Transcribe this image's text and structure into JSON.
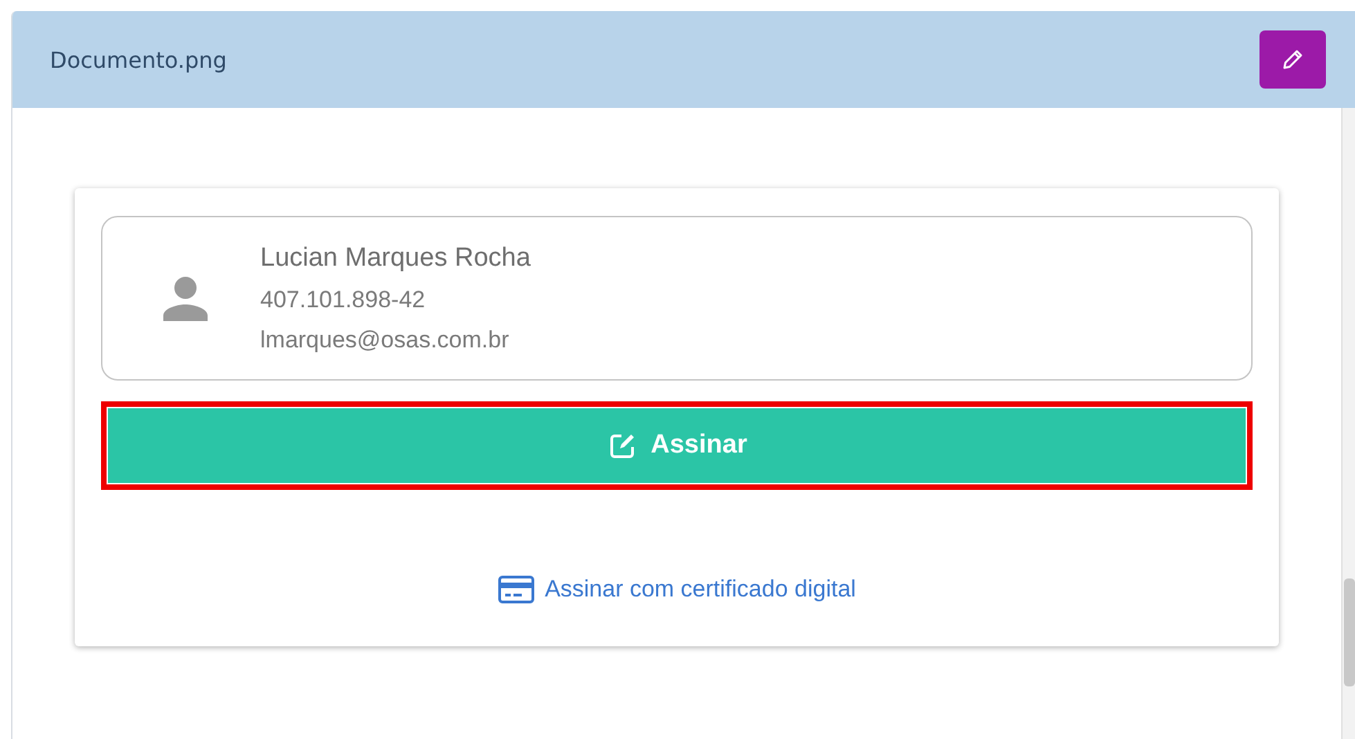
{
  "panel": {
    "title": "Documento.png"
  },
  "signer": {
    "name": "Lucian Marques Rocha",
    "document": "407.101.898-42",
    "email": "lmarques@osas.com.br"
  },
  "sign_button": {
    "label": "Assinar",
    "highlighted": true
  },
  "certificate_link": {
    "label": "Assinar com certificado digital"
  }
}
